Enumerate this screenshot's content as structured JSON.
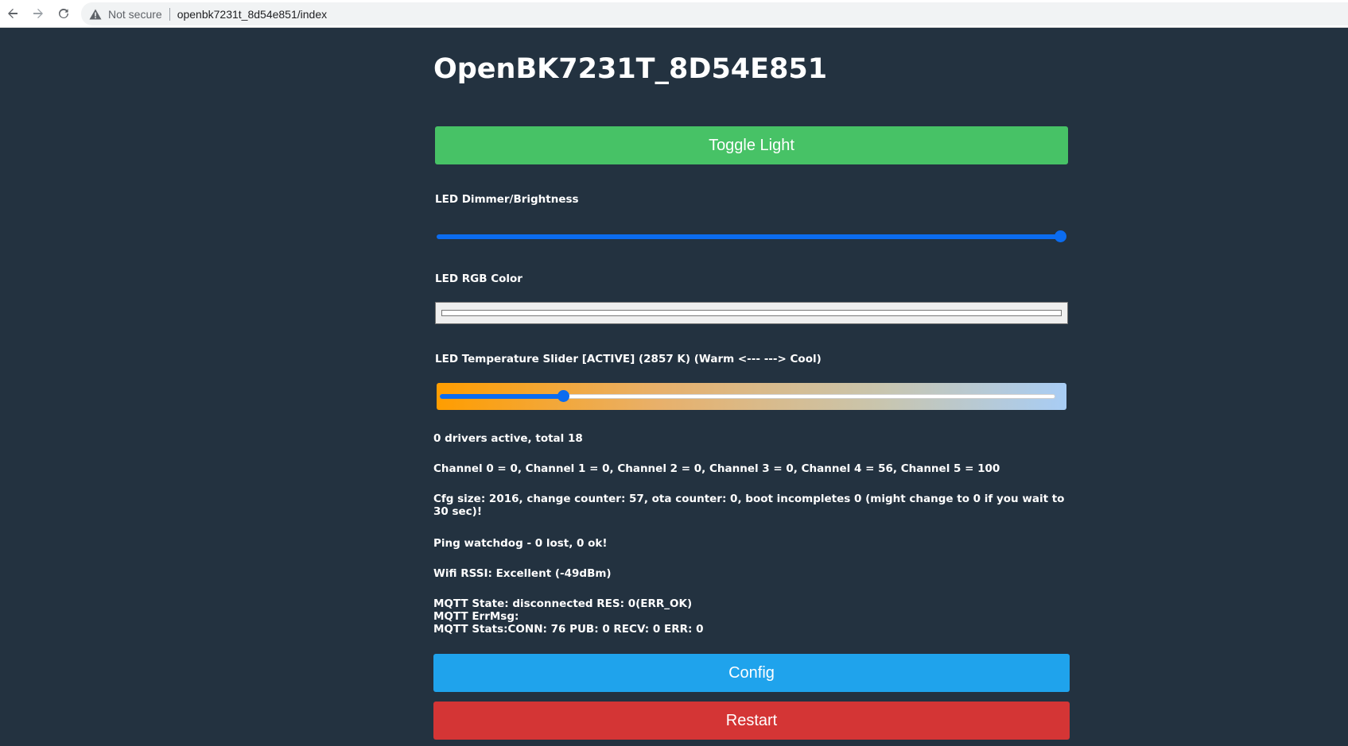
{
  "browser": {
    "security_label": "Not secure",
    "url": "openbk7231t_8d54e851/index"
  },
  "page": {
    "title": "OpenBK7231T_8D54E851",
    "toggle_label": "Toggle Light",
    "dimmer_label": "LED Dimmer/Brightness",
    "dimmer_value": 100,
    "rgb_label": "LED RGB Color",
    "rgb_color": "#ffffff",
    "temperature_label": "LED Temperature Slider [ACTIVE] (2857 K) (Warm <--- ---> Cool)",
    "temperature_fraction": 0.2,
    "drivers_text": "0 drivers active, total 18",
    "channels_text": "Channel 0 = 0, Channel 1 = 0, Channel 2 = 0, Channel 3 = 0, Channel 4 = 56, Channel 5 = 100",
    "cfg_text": "Cfg size: 2016, change counter: 57, ota counter: 0, boot incompletes 0 (might change to 0 if you wait to 30 sec)!",
    "ping_text": "Ping watchdog - 0 lost, 0 ok!",
    "wifi_text": "Wifi RSSI: Excellent (-49dBm)",
    "mqtt_state": "MQTT State: disconnected RES: 0(ERR_OK)",
    "mqtt_errmsg": "MQTT ErrMsg:",
    "mqtt_stats": "MQTT Stats:CONN: 76 PUB: 0 RECV: 0 ERR: 0",
    "config_label": "Config",
    "restart_label": "Restart"
  },
  "colors": {
    "background": "#233240",
    "toggle": "#47c266",
    "config": "#1fa3ec",
    "restart": "#d43535",
    "slider": "#0b6cf0"
  },
  "icons": {
    "back": "arrow-left-icon",
    "forward": "arrow-right-icon",
    "reload": "reload-icon",
    "security": "warning-triangle-icon"
  }
}
